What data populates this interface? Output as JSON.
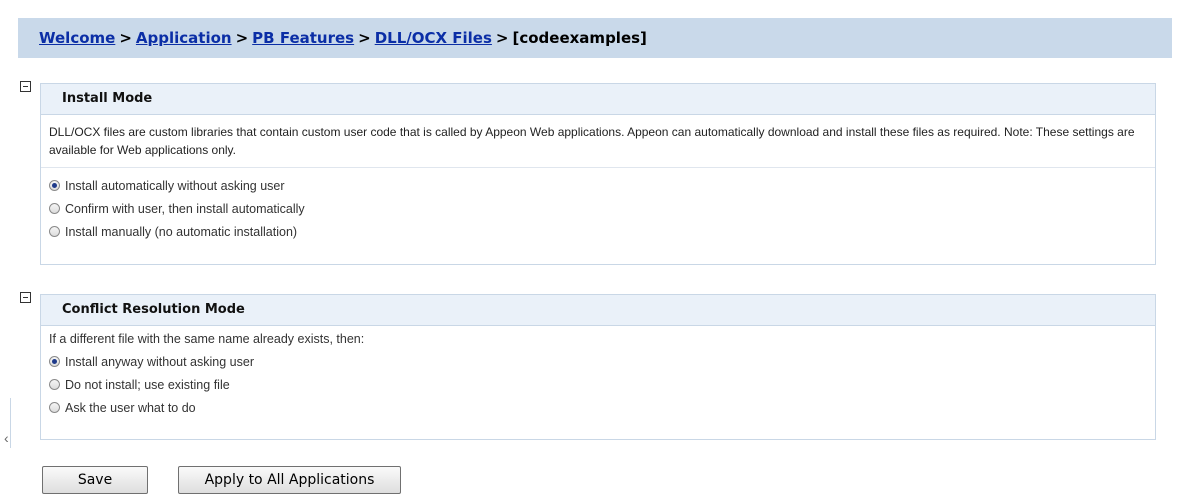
{
  "breadcrumb": {
    "items": [
      "Welcome",
      "Application",
      "PB Features ",
      "DLL/OCX Files"
    ],
    "current": "[codeexamples]",
    "separator": ">"
  },
  "install_mode": {
    "title": "Install Mode",
    "description": "DLL/OCX files are custom libraries that contain custom user code that is called by Appeon Web applications. Appeon can automatically download and install these files as required. Note: These settings are available for Web applications only.",
    "options": [
      {
        "label": "Install automatically without asking user",
        "selected": true
      },
      {
        "label": "Confirm with user, then install automatically",
        "selected": false
      },
      {
        "label": "Install manually (no automatic installation)",
        "selected": false
      }
    ]
  },
  "conflict_mode": {
    "title": "Conflict Resolution Mode",
    "intro": "If a different file with the same name already exists, then:",
    "options": [
      {
        "label": "Install anyway without asking user",
        "selected": true
      },
      {
        "label": "Do not install; use existing file",
        "selected": false
      },
      {
        "label": "Ask the user what to do",
        "selected": false
      }
    ]
  },
  "buttons": {
    "save": "Save",
    "apply_all": "Apply to All Applications"
  }
}
